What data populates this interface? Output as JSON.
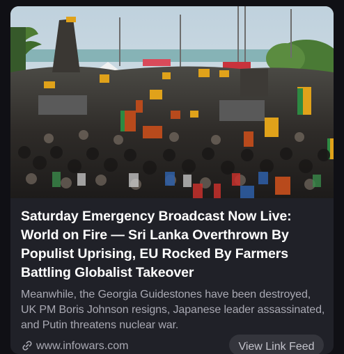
{
  "post": {
    "headline": "Saturday Emergency Broadcast Now Live: World on Fire — Sri Lanka Overthrown By Populist Uprising, EU Rocked By Farmers Battling Globalist Takeover",
    "description": "Meanwhile, the Georgia Guidestones have been destroyed, UK PM Boris Johnson resigns, Japanese leader assassinated, and Putin threatens nuclear war.",
    "domain": "www.infowars.com",
    "view_button_label": "View Link Feed",
    "link_icon": "link-icon",
    "preview_image": "crowd-protest-photo"
  },
  "colors": {
    "page_background": "#101015",
    "card_background": "#202128",
    "headline": "#ffffff",
    "secondary_text": "#a9a9b3",
    "button_background": "#34353c"
  }
}
